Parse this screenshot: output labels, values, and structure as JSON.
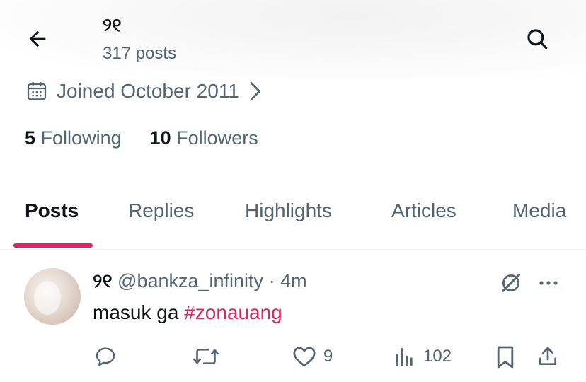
{
  "header": {
    "title": "୨୧",
    "posts_count": "317 posts"
  },
  "profile": {
    "joined": "Joined October 2011",
    "following_count": "5",
    "following_label": "Following",
    "followers_count": "10",
    "followers_label": "Followers"
  },
  "tabs": [
    {
      "label": "Posts",
      "active": true
    },
    {
      "label": "Replies",
      "active": false
    },
    {
      "label": "Highlights",
      "active": false
    },
    {
      "label": "Articles",
      "active": false
    },
    {
      "label": "Media",
      "active": false
    }
  ],
  "post": {
    "display_name": "୨୧",
    "handle": "@bankza_infinity",
    "separator": "·",
    "time": "4m",
    "text_prefix": "masuk ga ",
    "hashtag": "#zonauang",
    "likes": "9",
    "views": "102"
  },
  "colors": {
    "accent": "#e0245e",
    "muted": "#536471",
    "text": "#0f1419"
  }
}
